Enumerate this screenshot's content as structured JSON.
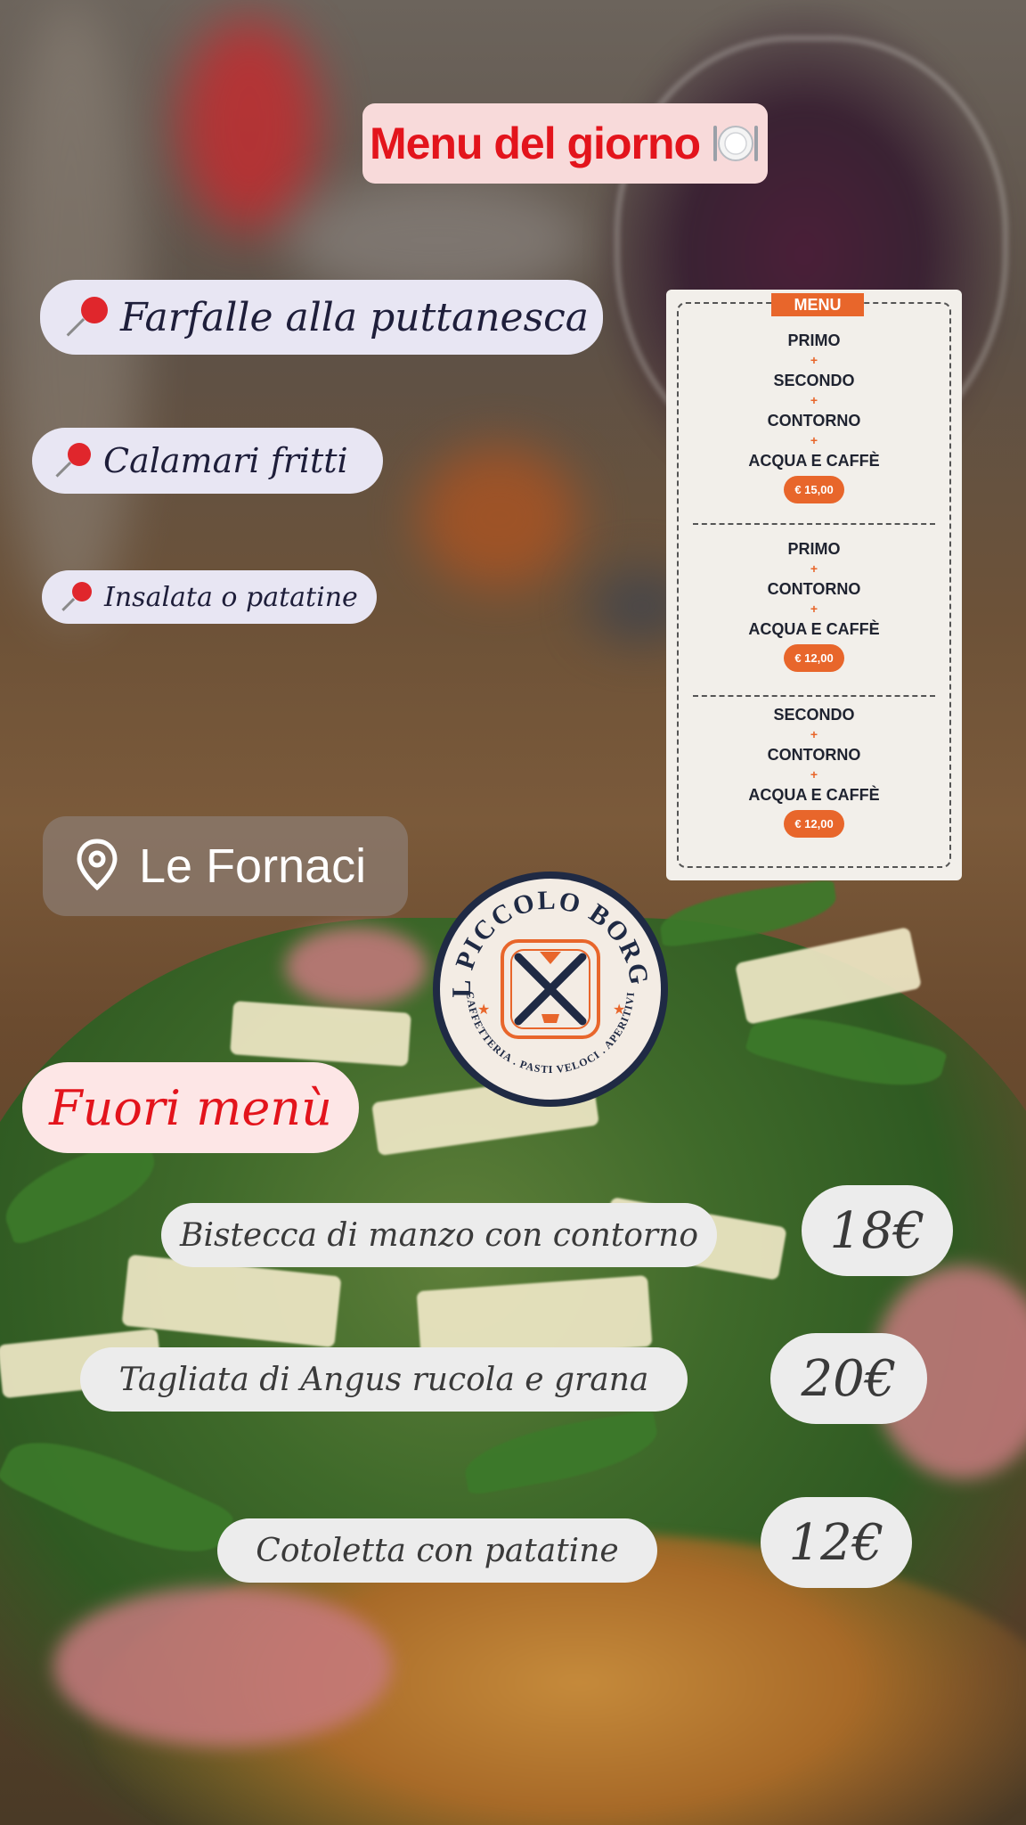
{
  "title": {
    "text": "Menu del giorno",
    "icon": "plate-cutlery-icon"
  },
  "daily_items": [
    {
      "label": "Farfalle alla puttanesca",
      "icon": "pushpin-icon"
    },
    {
      "label": "Calamari fritti",
      "icon": "pushpin-icon"
    },
    {
      "label": "Insalata o patatine",
      "icon": "pushpin-icon"
    }
  ],
  "menu_card": {
    "header": "MENU",
    "plus": "+",
    "combos": [
      {
        "items": [
          "PRIMO",
          "SECONDO",
          "CONTORNO",
          "ACQUA E CAFFÈ"
        ],
        "price": "€ 15,00"
      },
      {
        "items": [
          "PRIMO",
          "CONTORNO",
          "ACQUA E CAFFÈ"
        ],
        "price": "€ 12,00"
      },
      {
        "items": [
          "SECONDO",
          "CONTORNO",
          "ACQUA E CAFFÈ"
        ],
        "price": "€ 12,00"
      }
    ]
  },
  "location": {
    "label": "Le Fornaci",
    "icon": "location-pin-icon"
  },
  "logo": {
    "top": "IL PICCOLO BORGO",
    "bottom": "CAFFETTERIA . PASTI VELOCI . APERITIVI"
  },
  "fuori_menu": {
    "label": "Fuori menù",
    "dishes": [
      {
        "name": "Bistecca di manzo con contorno",
        "price": "18€"
      },
      {
        "name": "Tagliata di Angus rucola e grana",
        "price": "20€"
      },
      {
        "name": "Cotoletta con patatine",
        "price": "12€"
      }
    ]
  },
  "colors": {
    "accent_red": "#e3141c",
    "menu_orange": "#e8662b",
    "pill_bg": "#e8e6f3"
  }
}
